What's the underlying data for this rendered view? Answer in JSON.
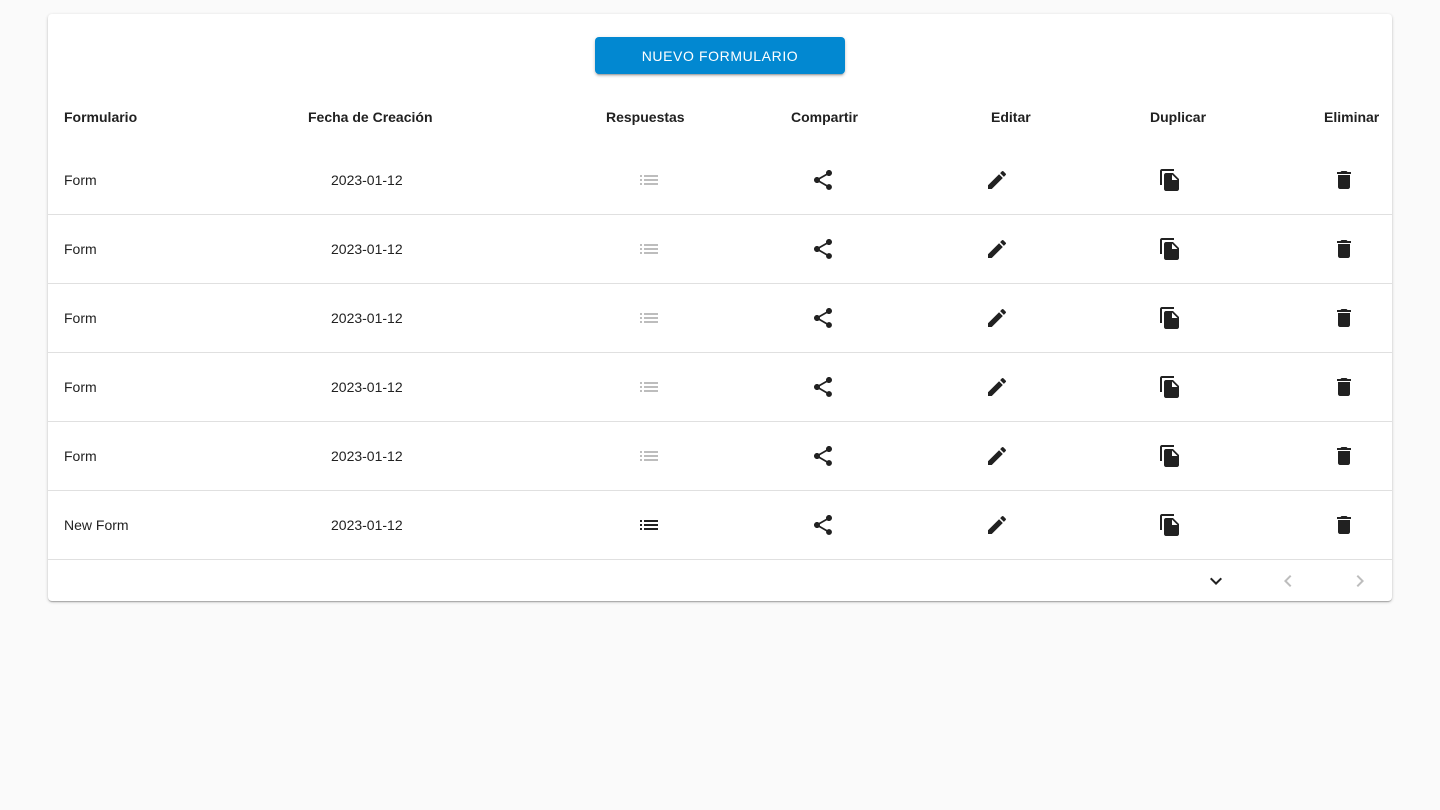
{
  "toolbar": {
    "new_button_label": "NUEVO FORMULARIO"
  },
  "table": {
    "headers": {
      "formulario": "Formulario",
      "fecha": "Fecha de Creación",
      "respuestas": "Respuestas",
      "compartir": "Compartir",
      "editar": "Editar",
      "duplicar": "Duplicar",
      "eliminar": "Eliminar"
    },
    "rows": [
      {
        "name": "Form",
        "date": "2023-01-12",
        "responses_available": false
      },
      {
        "name": "Form",
        "date": "2023-01-12",
        "responses_available": false
      },
      {
        "name": "Form",
        "date": "2023-01-12",
        "responses_available": false
      },
      {
        "name": "Form",
        "date": "2023-01-12",
        "responses_available": false
      },
      {
        "name": "Form",
        "date": "2023-01-12",
        "responses_available": false
      },
      {
        "name": "New Form",
        "date": "2023-01-12",
        "responses_available": true
      }
    ]
  },
  "icons": {
    "responses": "list-icon",
    "share": "share-icon",
    "edit": "pencil-icon",
    "duplicate": "file-copy-icon",
    "delete": "trash-icon",
    "rows_per_page": "chevron-down-icon",
    "prev": "chevron-left-icon",
    "next": "chevron-right-icon"
  },
  "colors": {
    "primary": "#0288d1",
    "background": "#fafafa",
    "icon_dark": "#212121",
    "icon_disabled": "#bdbdbd"
  }
}
